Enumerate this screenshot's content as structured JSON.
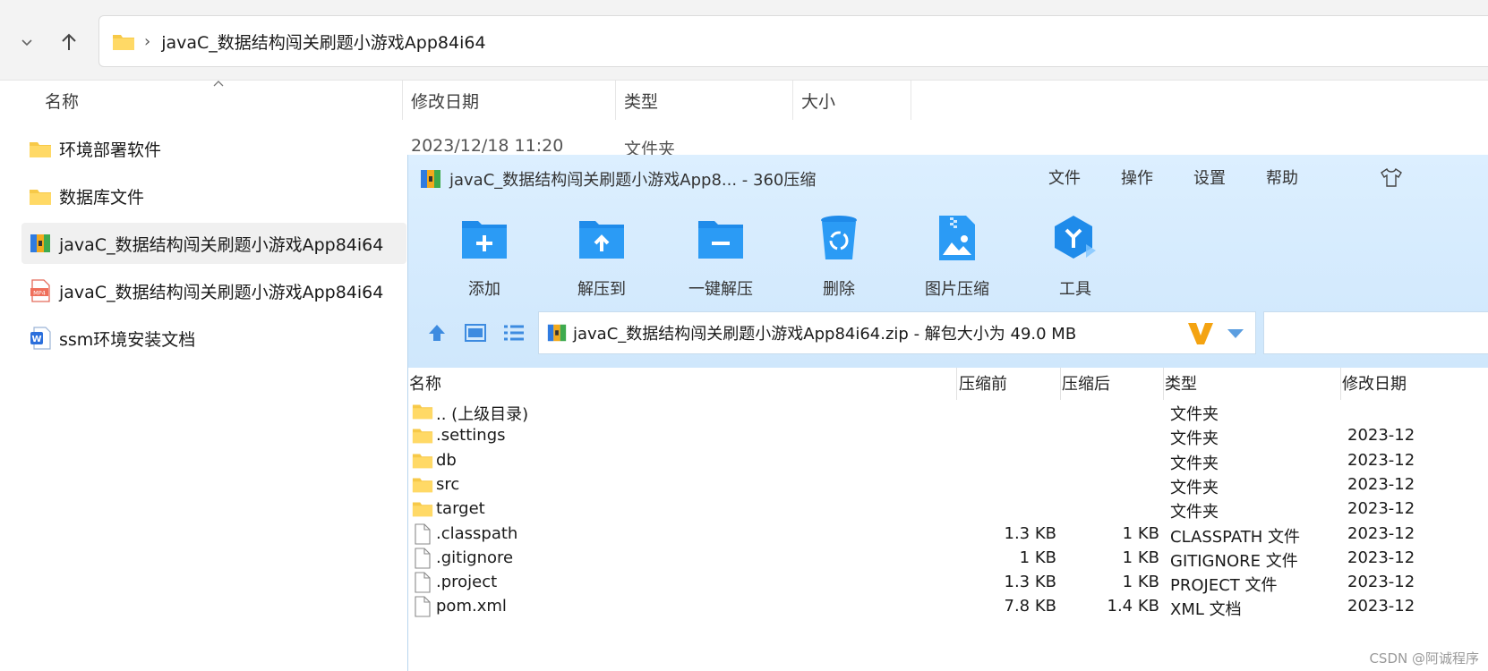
{
  "explorer": {
    "path_label": "javaC_数据结构闯关刷题小游戏App84i64",
    "columns": {
      "name": "名称",
      "modified": "修改日期",
      "type": "类型",
      "size": "大小"
    },
    "items": [
      {
        "name": "环境部署软件",
        "icon": "folder-icon"
      },
      {
        "name": "数据库文件",
        "icon": "folder-icon"
      },
      {
        "name": "javaC_数据结构闯关刷题小游戏App84i64",
        "icon": "zip-archive-icon"
      },
      {
        "name": "javaC_数据结构闯关刷题小游戏App84i64",
        "icon": "mp4-file-icon"
      },
      {
        "name": "ssm环境安装文档",
        "icon": "word-doc-icon"
      }
    ],
    "first_item_date": "2023/12/18 11:20",
    "first_item_type": "文件夹"
  },
  "archiver": {
    "title": "javaC_数据结构闯关刷题小游戏App8... - 360压缩",
    "menu": [
      "文件",
      "操作",
      "设置",
      "帮助"
    ],
    "tools": [
      {
        "label": "添加",
        "icon": "add-folder-icon"
      },
      {
        "label": "解压到",
        "icon": "extract-to-folder-icon"
      },
      {
        "label": "一键解压",
        "icon": "one-click-extract-icon"
      },
      {
        "label": "删除",
        "icon": "recycle-bin-icon"
      },
      {
        "label": "图片压缩",
        "icon": "image-compress-icon"
      },
      {
        "label": "工具",
        "icon": "tools-hexagon-icon"
      }
    ],
    "path": "javaC_数据结构闯关刷题小游戏App84i64.zip - 解包大小为 49.0 MB",
    "columns": {
      "name": "名称",
      "before": "压缩前",
      "after": "压缩后",
      "type": "类型",
      "modified": "修改日期"
    },
    "rows": [
      {
        "name": ".. (上级目录)",
        "before": "",
        "after": "",
        "type": "文件夹",
        "date": "",
        "icon": "folder-icon"
      },
      {
        "name": ".settings",
        "before": "",
        "after": "",
        "type": "文件夹",
        "date": "2023-12",
        "icon": "folder-icon"
      },
      {
        "name": "db",
        "before": "",
        "after": "",
        "type": "文件夹",
        "date": "2023-12",
        "icon": "folder-icon"
      },
      {
        "name": "src",
        "before": "",
        "after": "",
        "type": "文件夹",
        "date": "2023-12",
        "icon": "folder-icon"
      },
      {
        "name": "target",
        "before": "",
        "after": "",
        "type": "文件夹",
        "date": "2023-12",
        "icon": "folder-icon"
      },
      {
        "name": ".classpath",
        "before": "1.3 KB",
        "after": "1 KB",
        "type": "CLASSPATH 文件",
        "date": "2023-12",
        "icon": "file-icon"
      },
      {
        "name": ".gitignore",
        "before": "1 KB",
        "after": "1 KB",
        "type": "GITIGNORE 文件",
        "date": "2023-12",
        "icon": "file-icon"
      },
      {
        "name": ".project",
        "before": "1.3 KB",
        "after": "1 KB",
        "type": "PROJECT 文件",
        "date": "2023-12",
        "icon": "file-icon"
      },
      {
        "name": "pom.xml",
        "before": "7.8 KB",
        "after": "1.4 KB",
        "type": "XML 文档",
        "date": "2023-12",
        "icon": "file-icon"
      }
    ]
  },
  "watermark": "CSDN @阿诚程序"
}
